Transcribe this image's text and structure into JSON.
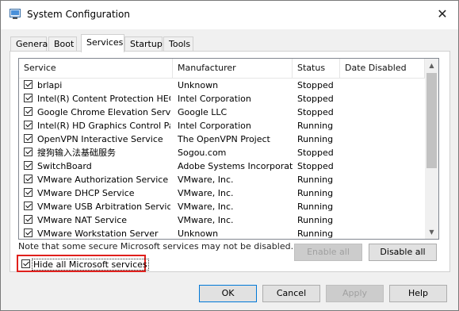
{
  "window": {
    "title": "System Configuration",
    "icon": "msconfig-icon"
  },
  "tabs": [
    {
      "label": "General"
    },
    {
      "label": "Boot"
    },
    {
      "label": "Services"
    },
    {
      "label": "Startup"
    },
    {
      "label": "Tools"
    }
  ],
  "active_tab": "Services",
  "columns": {
    "service": "Service",
    "manufacturer": "Manufacturer",
    "status": "Status",
    "date_disabled": "Date Disabled"
  },
  "services": [
    {
      "name": "brlapi",
      "manufacturer": "Unknown",
      "status": "Stopped",
      "date_disabled": "",
      "checked": true
    },
    {
      "name": "Intel(R) Content Protection HEC...",
      "manufacturer": "Intel Corporation",
      "status": "Stopped",
      "date_disabled": "",
      "checked": true
    },
    {
      "name": "Google Chrome Elevation Servic...",
      "manufacturer": "Google LLC",
      "status": "Stopped",
      "date_disabled": "",
      "checked": true
    },
    {
      "name": "Intel(R) HD Graphics Control Pa...",
      "manufacturer": "Intel Corporation",
      "status": "Running",
      "date_disabled": "",
      "checked": true
    },
    {
      "name": "OpenVPN Interactive Service",
      "manufacturer": "The OpenVPN Project",
      "status": "Running",
      "date_disabled": "",
      "checked": true
    },
    {
      "name": "搜狗输入法基础服务",
      "manufacturer": "Sogou.com",
      "status": "Stopped",
      "date_disabled": "",
      "checked": true
    },
    {
      "name": "SwitchBoard",
      "manufacturer": "Adobe Systems Incorporated",
      "status": "Stopped",
      "date_disabled": "",
      "checked": true
    },
    {
      "name": "VMware Authorization Service",
      "manufacturer": "VMware, Inc.",
      "status": "Running",
      "date_disabled": "",
      "checked": true
    },
    {
      "name": "VMware DHCP Service",
      "manufacturer": "VMware, Inc.",
      "status": "Running",
      "date_disabled": "",
      "checked": true
    },
    {
      "name": "VMware USB Arbitration Service",
      "manufacturer": "VMware, Inc.",
      "status": "Running",
      "date_disabled": "",
      "checked": true
    },
    {
      "name": "VMware NAT Service",
      "manufacturer": "VMware, Inc.",
      "status": "Running",
      "date_disabled": "",
      "checked": true
    },
    {
      "name": "VMware Workstation Server",
      "manufacturer": "Unknown",
      "status": "Running",
      "date_disabled": "",
      "checked": true
    }
  ],
  "note": "Note that some secure Microsoft services may not be disabled.",
  "buttons": {
    "enable_all": "Enable all",
    "disable_all": "Disable all",
    "ok": "OK",
    "cancel": "Cancel",
    "apply": "Apply",
    "help": "Help"
  },
  "hide_microsoft": {
    "label": "Hide all Microsoft services",
    "checked": true
  },
  "colors": {
    "highlight_border": "#e0201c",
    "focus_border": "#0078d7"
  }
}
